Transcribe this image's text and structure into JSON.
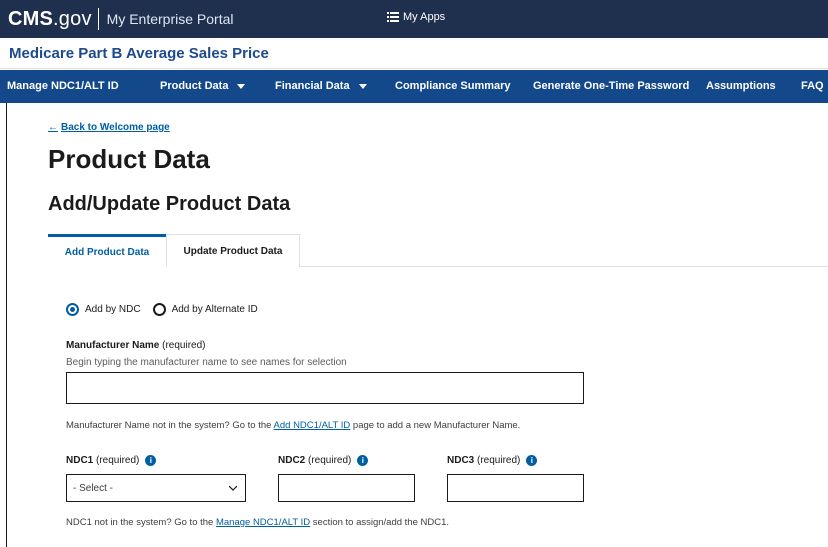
{
  "topbar": {
    "logo_main": "CMS",
    "logo_suffix": ".gov",
    "portal_title": "My Enterprise Portal",
    "my_apps": "My Apps",
    "my_apps_icon": "menu-list-icon"
  },
  "app": {
    "title": "Medicare Part B Average Sales Price"
  },
  "nav": {
    "items": [
      {
        "label": "Manage NDC1/ALT ID"
      },
      {
        "label": "Product Data"
      },
      {
        "label": "Financial Data"
      },
      {
        "label": "Compliance Summary"
      },
      {
        "label": "Generate One-Time Password"
      },
      {
        "label": "Assumptions"
      },
      {
        "label": "FAQ"
      }
    ]
  },
  "back_link": "Back to Welcome page",
  "page_title": "Product Data",
  "section_title": "Add/Update Product Data",
  "tabs": [
    {
      "label": "Add Product Data",
      "active": true
    },
    {
      "label": "Update Product Data",
      "active": false
    }
  ],
  "radio_options": [
    {
      "label": "Add by NDC",
      "checked": true
    },
    {
      "label": "Add by Alternate ID",
      "checked": false
    }
  ],
  "manufacturer": {
    "label": "Manufacturer Name",
    "required": "(required)",
    "hint": "Begin typing the manufacturer name to see names for selection",
    "value": "",
    "helper_prefix": "Manufacturer Name not in the system? Go to the ",
    "helper_link": "Add NDC1/ALT ID",
    "helper_suffix": " page to add a new Manufacturer Name."
  },
  "ndc": {
    "ndc1_label": "NDC1",
    "ndc2_label": "NDC2",
    "ndc3_label": "NDC3",
    "required": "(required)",
    "ndc1_selected": "- Select -",
    "ndc2_value": "",
    "ndc3_value": "",
    "helper_prefix": "NDC1 not in the system? Go to the ",
    "helper_link": "Manage NDC1/ALT ID",
    "helper_suffix": " section to assign/add the NDC1."
  },
  "colors": {
    "topbar": "#1f2f4e",
    "nav": "#13488a",
    "accent": "#005ea2",
    "app_title": "#1c4a8c"
  }
}
